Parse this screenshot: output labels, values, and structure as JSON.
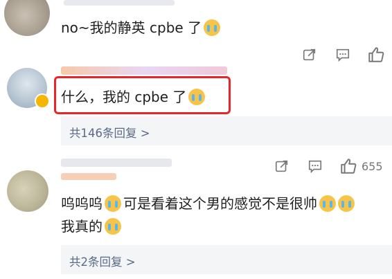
{
  "comments": [
    {
      "text": "no~我的静英 cpbe 了"
    },
    {
      "text": "什么，我的 cpbe 了"
    },
    {
      "line1": "呜呜呜",
      "line1b": "可是看着这个男的感觉不是很帅",
      "line2": "我真的"
    }
  ],
  "replies": [
    {
      "label": "共146条回复 >"
    },
    {
      "label": "共2条回复 >"
    }
  ],
  "actions": {
    "likes_count": "655"
  },
  "colors": {
    "highlight": "#e8262a",
    "reply_text": "#5a6a86",
    "reply_bg": "#f4f5f7"
  }
}
